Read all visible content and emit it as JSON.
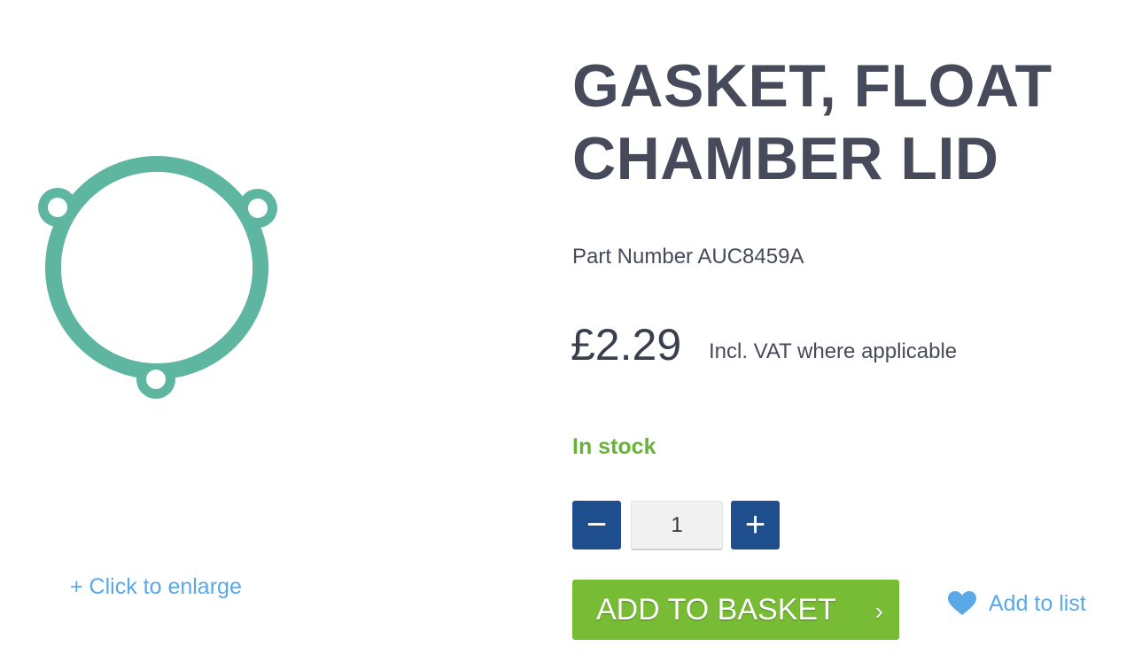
{
  "product": {
    "title": "GASKET, FLOAT CHAMBER LID",
    "part_number": "Part Number AUC8459A",
    "price": "£2.29",
    "vat_note": "Incl. VAT where applicable",
    "stock_status": "In stock",
    "image_alt": "Gasket, float chamber lid"
  },
  "image": {
    "enlarge_label": "+ Click to enlarge",
    "gasket_color": "#5fb6a0"
  },
  "quantity": {
    "minus_label": "−",
    "plus_label": "+",
    "value": "1"
  },
  "actions": {
    "add_to_basket_label": "ADD TO BASKET",
    "add_to_basket_chevron": "›",
    "add_to_list_label": "Add to list",
    "heart_icon": "heart-icon"
  },
  "colors": {
    "title": "#474a5a",
    "in_stock": "#6ab23a",
    "qty_button": "#1f4e8f",
    "basket_button": "#78bb34",
    "link": "#5aa9e6"
  }
}
